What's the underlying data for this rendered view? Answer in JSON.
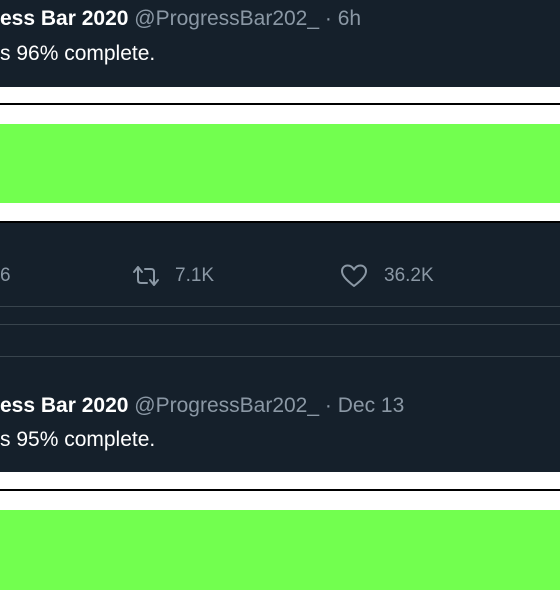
{
  "colors": {
    "background": "#15202b",
    "muted_text": "#8b98a5",
    "progress_fill": "#72ff4f",
    "divider": "#38444d"
  },
  "tweets": [
    {
      "display_name": "ess Bar 2020",
      "handle": "@ProgressBar202_",
      "separator": "·",
      "time": "6h",
      "text": "s 96% complete.",
      "progress": 0.96,
      "actions": {
        "reply_count": "6",
        "retweet_icon": "retweet-icon",
        "retweet_count": "7.1K",
        "like_icon": "heart-icon",
        "like_count": "36.2K"
      }
    },
    {
      "display_name": "ess Bar 2020",
      "handle": "@ProgressBar202_",
      "separator": "·",
      "time": "Dec 13",
      "text": "s 95% complete.",
      "progress": 0.95
    }
  ]
}
